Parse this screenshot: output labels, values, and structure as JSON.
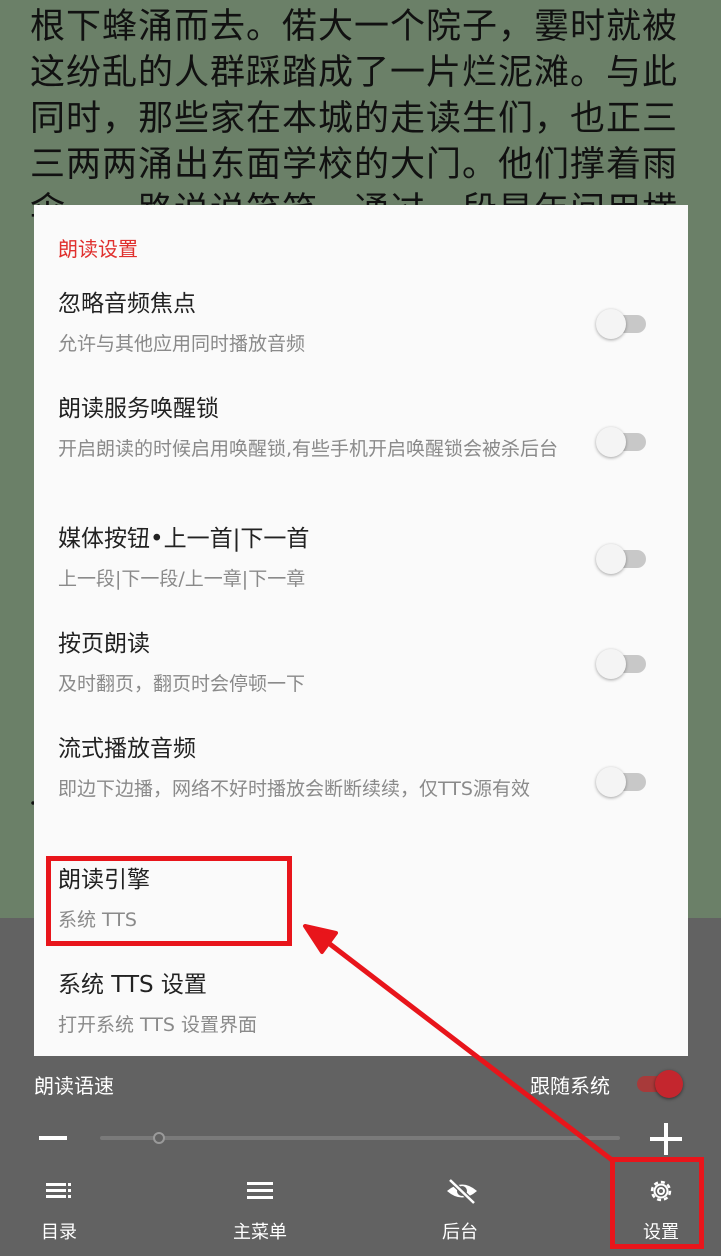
{
  "reader": {
    "lines": [
      "根下蜂涌而去。偌大一个院子，霎时就被",
      "这纷乱的人群踩踏成了一片烂泥滩。与此",
      "同时，那些家在本城的走读生们，也正三",
      "三两两涌出东面学校的大门。他们撑着雨",
      "伞，一路说说笑笑，通过一段是年间用横"
    ]
  },
  "dialog": {
    "title": "朗读设置",
    "items": [
      {
        "title": "忽略音频焦点",
        "summary": "允许与其他应用同时播放音频",
        "switch": false
      },
      {
        "title": "朗读服务唤醒锁",
        "summary": "开启朗读的时候启用唤醒锁,有些手机开启唤醒锁会被杀后台",
        "switch": false
      },
      {
        "title": "媒体按钮•上一首|下一首",
        "summary": "上一段|下一段/上一章|下一章",
        "switch": false
      },
      {
        "title": "按页朗读",
        "summary": "及时翻页，翻页时会停顿一下",
        "switch": false
      },
      {
        "title": "流式播放音频",
        "summary": "即边下边播，网络不好时播放会断断续续，仅TTS源有效",
        "switch": false
      },
      {
        "title": "朗读引擎",
        "summary": "系统 TTS"
      },
      {
        "title": "系统 TTS 设置",
        "summary": "打开系统 TTS 设置界面"
      }
    ]
  },
  "panel": {
    "speed_label": "朗读语速",
    "follow_label": "跟随系统",
    "follow_switch": true,
    "speed_slider_value": 0.1
  },
  "nav": [
    {
      "label": "目录",
      "icon": "toc-icon"
    },
    {
      "label": "主菜单",
      "icon": "menu-icon"
    },
    {
      "label": "后台",
      "icon": "eye-off-icon"
    },
    {
      "label": "设置",
      "icon": "gear-icon"
    }
  ],
  "colors": {
    "accent": "#e0302e",
    "annotation": "#e8151b",
    "reader_bg": "#6b8068"
  }
}
